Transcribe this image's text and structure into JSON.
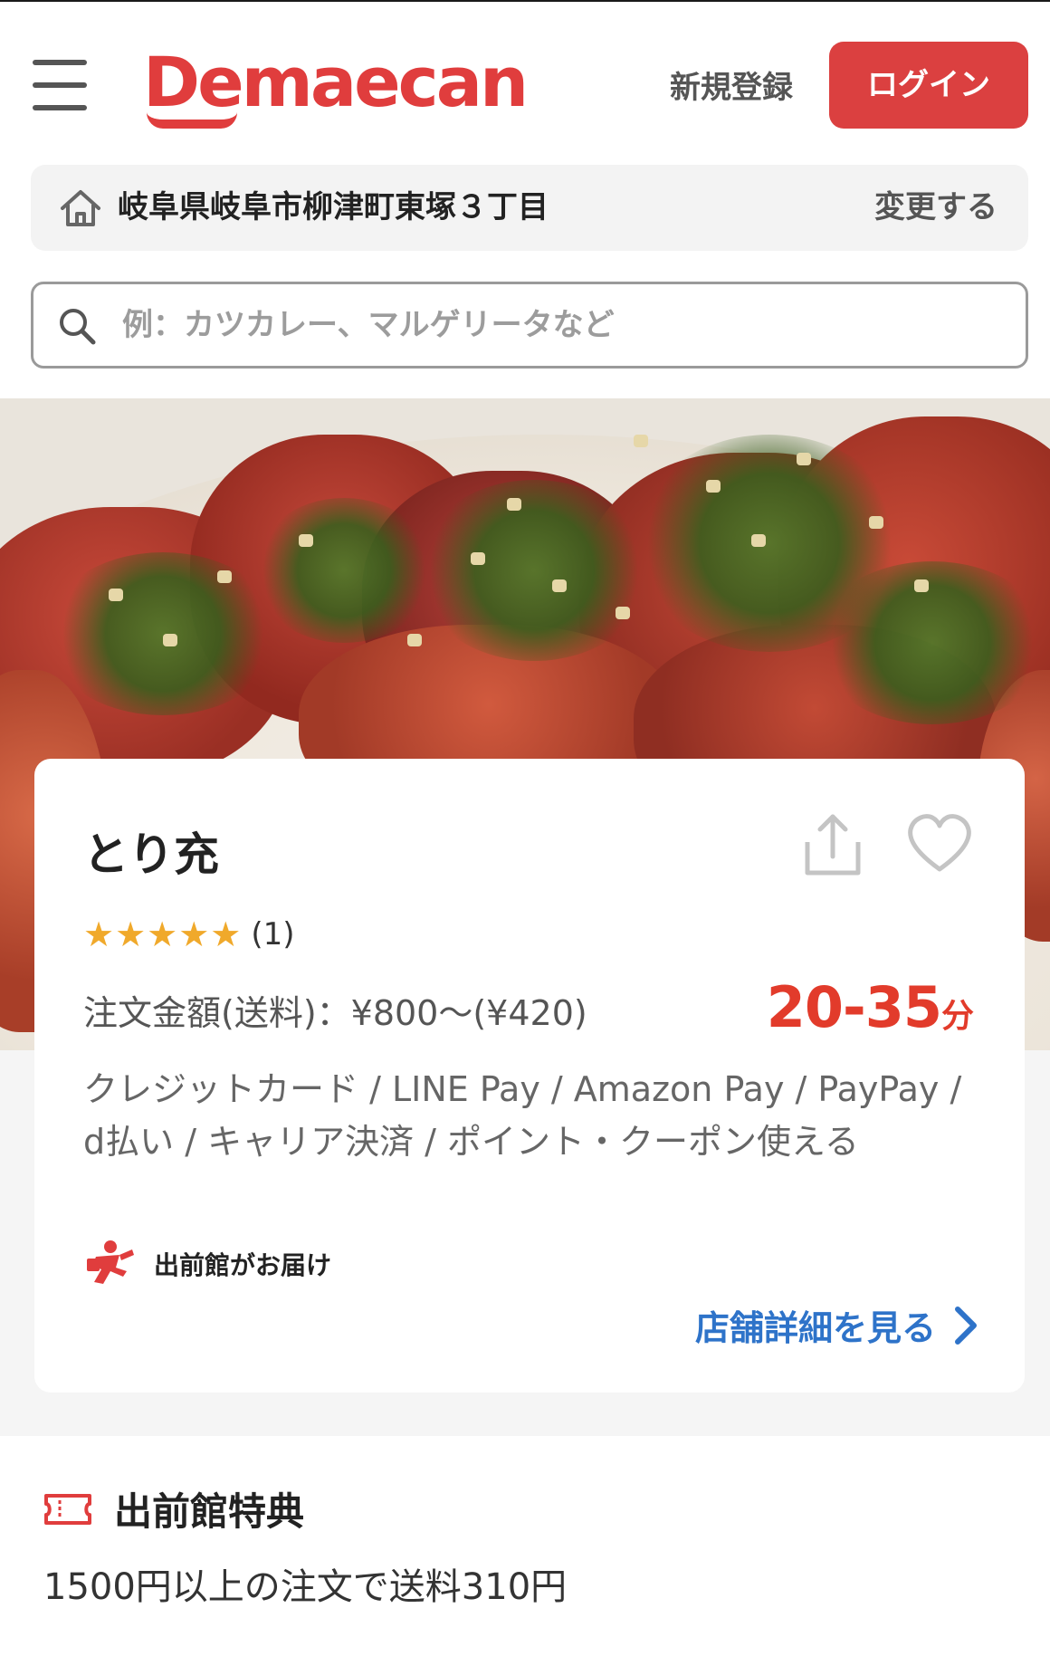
{
  "header": {
    "logo": "Demaecan",
    "signup_label": "新規登録",
    "login_label": "ログイン",
    "brand_color": "#e03d3d"
  },
  "address": {
    "text": "岐阜県岐阜市柳津町東塚３丁目",
    "change_label": "変更する",
    "icon": "home-icon"
  },
  "search": {
    "placeholder": "例：カツカレー、マルゲリータなど",
    "value": "",
    "icon": "search-icon"
  },
  "store": {
    "name": "とり充",
    "rating_stars": 5,
    "stars": "★★★★★",
    "review_count": "(1)",
    "fee_text": "注文金額(送料)：¥800〜(¥420)",
    "delivery_time": "20-35",
    "delivery_time_unit": "分",
    "payments": "クレジットカード / LINE Pay / Amazon Pay / PayPay / d払い / キャリア決済 / ポイント・クーポン使える",
    "delivered_by": "出前館がお届け",
    "details_link": "店舗詳細を見る",
    "accent_color": "#e23b2b",
    "link_color": "#2e73c9"
  },
  "perks": {
    "heading": "出前館特典",
    "description": "1500円以上の注文で送料310円"
  }
}
